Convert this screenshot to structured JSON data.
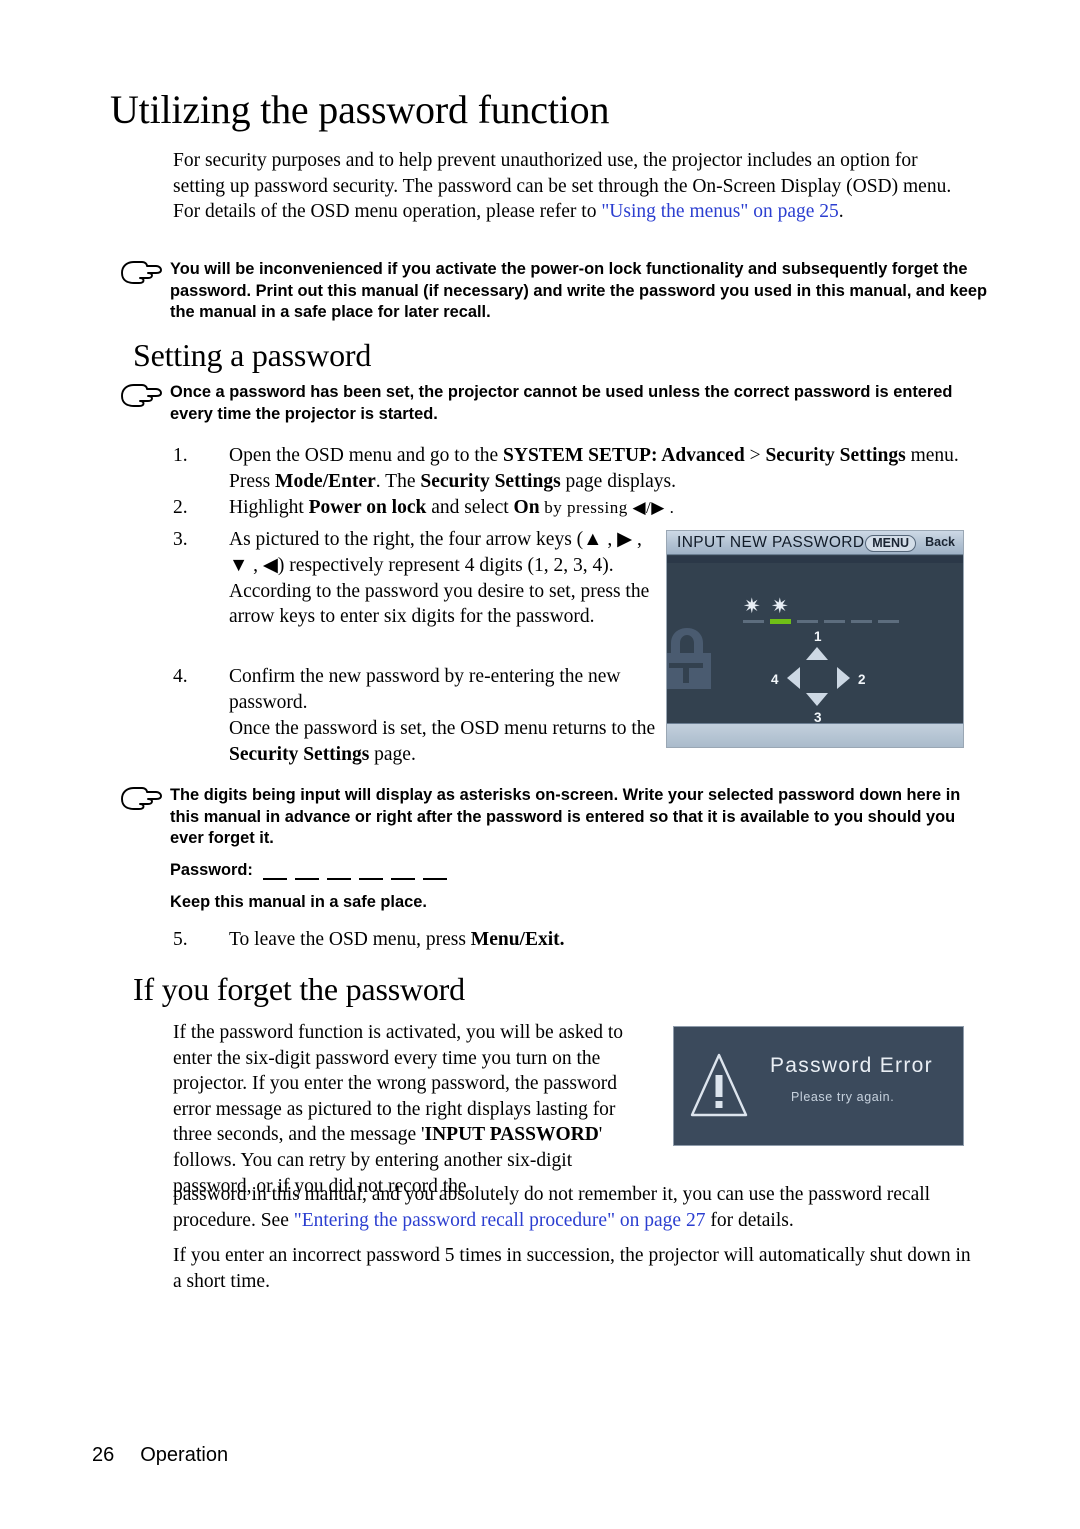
{
  "page": {
    "title": "Utilizing the password function",
    "footer_page_number": "26",
    "footer_section": "Operation"
  },
  "intro": {
    "text_before_link": "For security purposes and to help prevent unauthorized use, the projector includes an option for setting up password security. The password can be set through the On-Screen Display (OSD) menu. For details of the OSD menu operation, please refer to ",
    "link_text": "\"Using the menus\" on page 25",
    "text_after_link": "."
  },
  "notes": {
    "note_1": "You will be inconvenienced if you activate the power-on lock functionality and subsequently forget the password. Print out this manual (if necessary) and write the password you used in this manual, and keep the manual in a safe place for later recall.",
    "note_2": "Once a password has been set, the projector cannot be used unless the correct password is entered every time the projector is started.",
    "note_3": "The digits being input will display as asterisks on-screen. Write your selected password down here in this manual in advance or right after the password is entered so that it is available to you should you ever forget it.",
    "hand_icon": "pointing-hand-icon"
  },
  "sections": {
    "setting_a_password": "Setting a password",
    "if_you_forget": "If you forget the password"
  },
  "steps": [
    {
      "number": "1.",
      "parts": [
        {
          "text": "Open the OSD menu and go to the ",
          "bold": false
        },
        {
          "text": "SYSTEM SETUP: Advanced",
          "bold": true
        },
        {
          "text": " > ",
          "bold": false
        },
        {
          "text": "Security Settings",
          "bold": true
        },
        {
          "text": " menu. Press ",
          "bold": false
        },
        {
          "text": "Mode/Enter",
          "bold": true
        },
        {
          "text": ". The ",
          "bold": false
        },
        {
          "text": "Security Settings",
          "bold": true
        },
        {
          "text": " page displays.",
          "bold": false
        }
      ]
    },
    {
      "number": "2.",
      "parts": [
        {
          "text": "Highlight ",
          "bold": false
        },
        {
          "text": "Power on lock",
          "bold": true
        },
        {
          "text": " and select ",
          "bold": false
        },
        {
          "text": "On",
          "bold": true
        },
        {
          "text": " by pressing ◀/▶ .",
          "bold": false
        }
      ]
    },
    {
      "number": "3.",
      "parts": [
        {
          "text": "As pictured to the right, the four arrow keys (▲ , ▶ , ▼ , ◀) respectively represent 4 digits (1, 2, 3, 4). According to the password you desire to set, press the arrow keys to enter six digits for the password.",
          "bold": false
        }
      ]
    },
    {
      "number": "4.",
      "parts": [
        {
          "text": "Confirm the new password by re-entering the new password.",
          "bold": false
        }
      ]
    },
    {
      "number": "5.",
      "parts": [
        {
          "text": "To leave the OSD menu, press ",
          "bold": false
        },
        {
          "text": "Menu/Exit.",
          "bold": true
        }
      ]
    }
  ],
  "step_4_continuation": {
    "text_before": "Once the password is set, the OSD menu returns to the ",
    "bold_text": "Security Settings",
    "text_after": " page."
  },
  "password_record": {
    "label": "Password:",
    "blank_count": 6,
    "keep_note": "Keep this manual in a safe place."
  },
  "osd_input_password": {
    "title": "INPUT NEW PASSWORD",
    "entered_digits": 2,
    "total_slots": 6,
    "active_slot_index": 2,
    "star_glyph": "✷",
    "active_slot_color": "#6fbf17",
    "panel_bg_color": "#33414f",
    "arrow_labels": {
      "up": "1",
      "right": "2",
      "down": "3",
      "left": "4"
    },
    "footer_button": "MENU",
    "footer_action": "Back",
    "lock_watermark_icon": "padlock-icon"
  },
  "osd_password_error": {
    "title": "Password Error",
    "subtitle": "Please try again.",
    "warning_icon": "warning-triangle-icon",
    "panel_bg_color": "#3b4a5c"
  },
  "forget_section": {
    "paragraph_narrow_parts": [
      {
        "text": "If the password function is activated, you will be asked to enter the six-digit password every time you turn on the projector. If you enter the wrong password, the password error message as pictured to the right displays lasting for three seconds, and the message '",
        "bold": false
      },
      {
        "text": "INPUT PASSWORD",
        "bold": true
      },
      {
        "text": "' follows. You can retry by entering another six-digit password, or if you did not record the",
        "bold": false
      }
    ],
    "paragraph_wide_before": "password in this manual, and you absolutely do not remember it, you can use the password recall procedure. See ",
    "paragraph_wide_link": "\"Entering the password recall procedure\" on page 27",
    "paragraph_wide_after": " for details.",
    "paragraph_last": "If you enter an incorrect password 5 times in succession, the projector will automatically shut down in a short time."
  },
  "colors": {
    "link": "#2b3ed0",
    "osd_accent_green": "#6fbf17"
  }
}
